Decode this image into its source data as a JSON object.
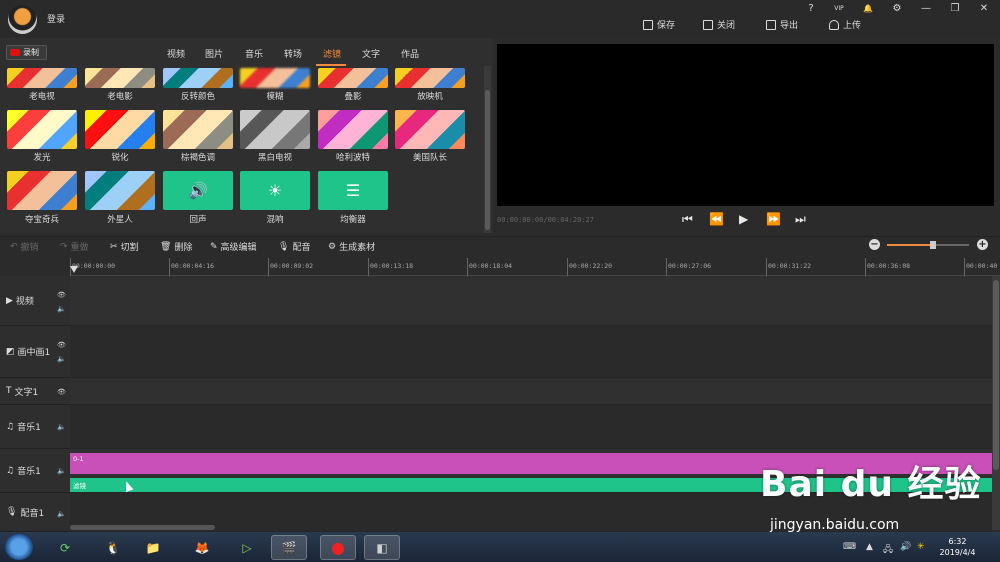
{
  "titlebar": {
    "login": "登录",
    "actions": [
      "保存",
      "关闭",
      "导出",
      "上传"
    ],
    "window_buttons": [
      "?",
      "VIP",
      "🔔",
      "⚙",
      "—",
      "❐",
      "✕"
    ]
  },
  "left": {
    "record": "录制",
    "tabs": [
      "视频",
      "图片",
      "音乐",
      "转场",
      "滤镜",
      "文字",
      "作品"
    ],
    "active_tab": "滤镜",
    "row1": [
      "老电视",
      "老电影",
      "反转颜色",
      "模糊",
      "叠影",
      "放映机"
    ],
    "row2": [
      "发光",
      "锐化",
      "棕褐色调",
      "黑白电视",
      "哈利波特",
      "美国队长"
    ],
    "row3": [
      "夺宝奇兵",
      "外星人",
      "回声",
      "混响",
      "均衡器"
    ]
  },
  "preview": {
    "timecode": "00:00:00:00/00:04:20:27",
    "buttons": [
      "⏮",
      "⏪",
      "▶",
      "⏩",
      "⏭"
    ]
  },
  "toolbar": {
    "undo": "撤销",
    "redo": "重做",
    "cut": "切割",
    "delete": "删除",
    "advanced": "高级编辑",
    "dub": "配音",
    "generate": "生成素材"
  },
  "ruler": [
    "00:00:00:00",
    "00:00:04:16",
    "00:00:09:02",
    "00:00:13:18",
    "00:00:18:04",
    "00:00:22:20",
    "00:00:27:06",
    "00:00:31:22",
    "00:00:36:08",
    "00:00:40"
  ],
  "tracks": [
    "视频",
    "画中画1",
    "文字1",
    "音乐1",
    "音乐1",
    "配音1"
  ],
  "clips": {
    "pink": "0-1",
    "green": "滤镜"
  },
  "taskbar": {
    "time": "6:32",
    "date": "2019/4/4"
  },
  "watermark": {
    "brand": "Bai du 经验",
    "url": "jingyan.baidu.com"
  },
  "colors": {
    "accent": "#f08a3c",
    "pink_clip": "#c850b8",
    "green_clip": "#1fc48b"
  }
}
